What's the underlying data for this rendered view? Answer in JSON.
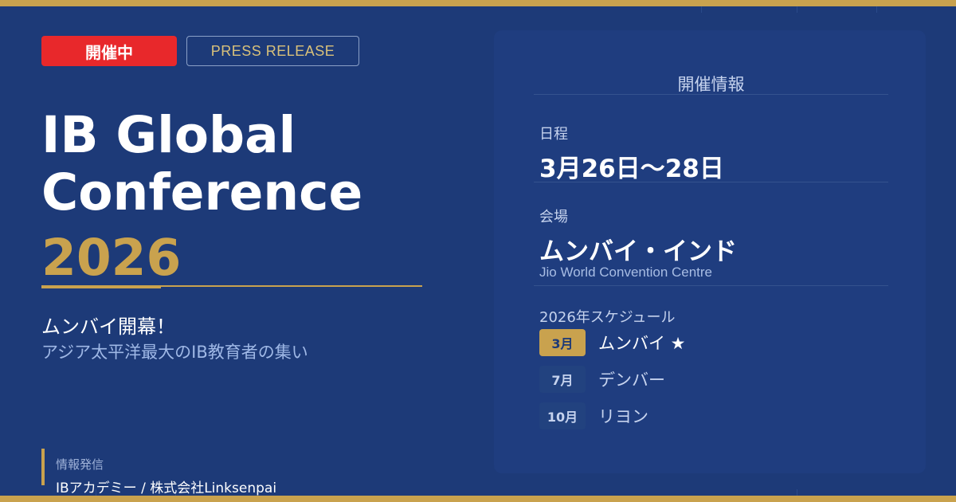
{
  "header": {
    "live_badge": "開催中",
    "press_badge": "PRESS RELEASE"
  },
  "hero": {
    "title_line1": "IB Global",
    "title_line2": "Conference",
    "year": "2026",
    "subtitle": "ムンバイ開幕！",
    "tagline": "アジア太平洋最大のIB教育者の集い"
  },
  "publisher": {
    "label": "情報発信",
    "value": "IBアカデミー / 株式会社Linksenpai"
  },
  "event_info": {
    "title": "開催情報",
    "date_label": "日程",
    "date_value": "3月26日〜28日",
    "venue_label": "会場",
    "venue_value": "ムンバイ・インド",
    "venue_en": "Jio World Convention Centre",
    "schedule_label": "2026年スケジュール",
    "schedule": [
      {
        "month": "3月",
        "city": "ムンバイ ★",
        "active": true
      },
      {
        "month": "7月",
        "city": "デンバー",
        "active": false
      },
      {
        "month": "10月",
        "city": "リヨン",
        "active": false
      }
    ]
  },
  "colors": {
    "background": "#1d3a78",
    "accent_gold": "#c9a24e",
    "live_red": "#e8282b",
    "panel": "#1f3d7f"
  }
}
